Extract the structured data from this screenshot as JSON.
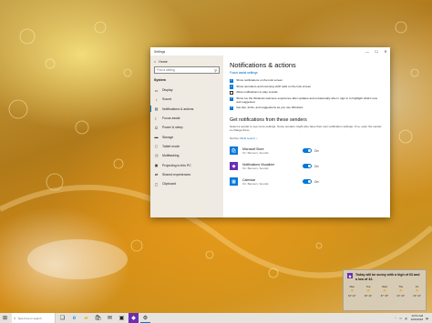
{
  "window": {
    "title": "Settings",
    "controls": {
      "minimize": "—",
      "maximize": "☐",
      "close": "✕"
    }
  },
  "sidebar": {
    "home_label": "Home",
    "search_placeholder": "Find a setting",
    "section_title": "System",
    "items": [
      {
        "label": "Display",
        "icon": "display-icon",
        "glyph": "▭"
      },
      {
        "label": "Sound",
        "icon": "sound-icon",
        "glyph": "♪"
      },
      {
        "label": "Notifications & actions",
        "icon": "notifications-icon",
        "glyph": "▤"
      },
      {
        "label": "Focus assist",
        "icon": "moon-icon",
        "glyph": "☾"
      },
      {
        "label": "Power & sleep",
        "icon": "power-icon",
        "glyph": "⏻"
      },
      {
        "label": "Storage",
        "icon": "storage-icon",
        "glyph": "▬"
      },
      {
        "label": "Tablet mode",
        "icon": "tablet-icon",
        "glyph": "▯"
      },
      {
        "label": "Multitasking",
        "icon": "multitasking-icon",
        "glyph": "❐"
      },
      {
        "label": "Projecting to this PC",
        "icon": "projecting-icon",
        "glyph": "▣"
      },
      {
        "label": "Shared experiences",
        "icon": "shared-icon",
        "glyph": "⇄"
      },
      {
        "label": "Clipboard",
        "icon": "clipboard-icon",
        "glyph": "▢"
      }
    ],
    "active_index": 2
  },
  "content": {
    "heading": "Notifications & actions",
    "focus_link": "Focus assist settings",
    "options": [
      {
        "label": "Show notifications on the lock screen",
        "checked": true
      },
      {
        "label": "Show reminders and incoming VoIP calls on the lock screen",
        "checked": true
      },
      {
        "label": "Allow notifications to play sounds",
        "checked": false
      },
      {
        "label": "Show me the Windows welcome experience after updates and occasionally when I sign in to highlight what's new and suggested",
        "checked": true
      },
      {
        "label": "Get tips, tricks, and suggestions as you use Windows",
        "checked": true
      }
    ],
    "senders_heading": "Get notifications from these senders",
    "senders_desc": "Select a sender to see more settings. Some senders might also have their own notification settings. If so, open the sender to change them.",
    "sort_label": "Sort by:",
    "sort_value": "Most recent",
    "senders": [
      {
        "name": "Microsoft Store",
        "sub": "On: Banners, Sounds",
        "color": "#0078d7",
        "icon": "store-icon",
        "glyph": "🛍",
        "toggle": "On"
      },
      {
        "name": "Notifications Visualizer",
        "sub": "On: Banners, Sounds",
        "color": "#6b2fb3",
        "icon": "visualizer-icon",
        "glyph": "◆",
        "toggle": "On"
      },
      {
        "name": "Calendar",
        "sub": "On: Banners, Sounds",
        "color": "#0078d7",
        "icon": "calendar-icon",
        "glyph": "▦",
        "toggle": "On"
      }
    ]
  },
  "toast": {
    "message": "Today will be sunny with a high of 63 and a low of 42.",
    "logo_icon": "app-logo-icon",
    "forecast": [
      {
        "day": "Mon",
        "hi_lo": "63° 42°"
      },
      {
        "day": "Tue",
        "hi_lo": "66° 44°"
      },
      {
        "day": "Wed",
        "hi_lo": "67° 45°"
      },
      {
        "day": "Thu",
        "hi_lo": "64° 43°"
      },
      {
        "day": "Fri",
        "hi_lo": "62° 42°"
      }
    ]
  },
  "taskbar": {
    "search_placeholder": "Type here to search",
    "time": "10:51 AM",
    "date": "9/26/2018",
    "colors": {
      "accent": "#0078d7"
    }
  }
}
